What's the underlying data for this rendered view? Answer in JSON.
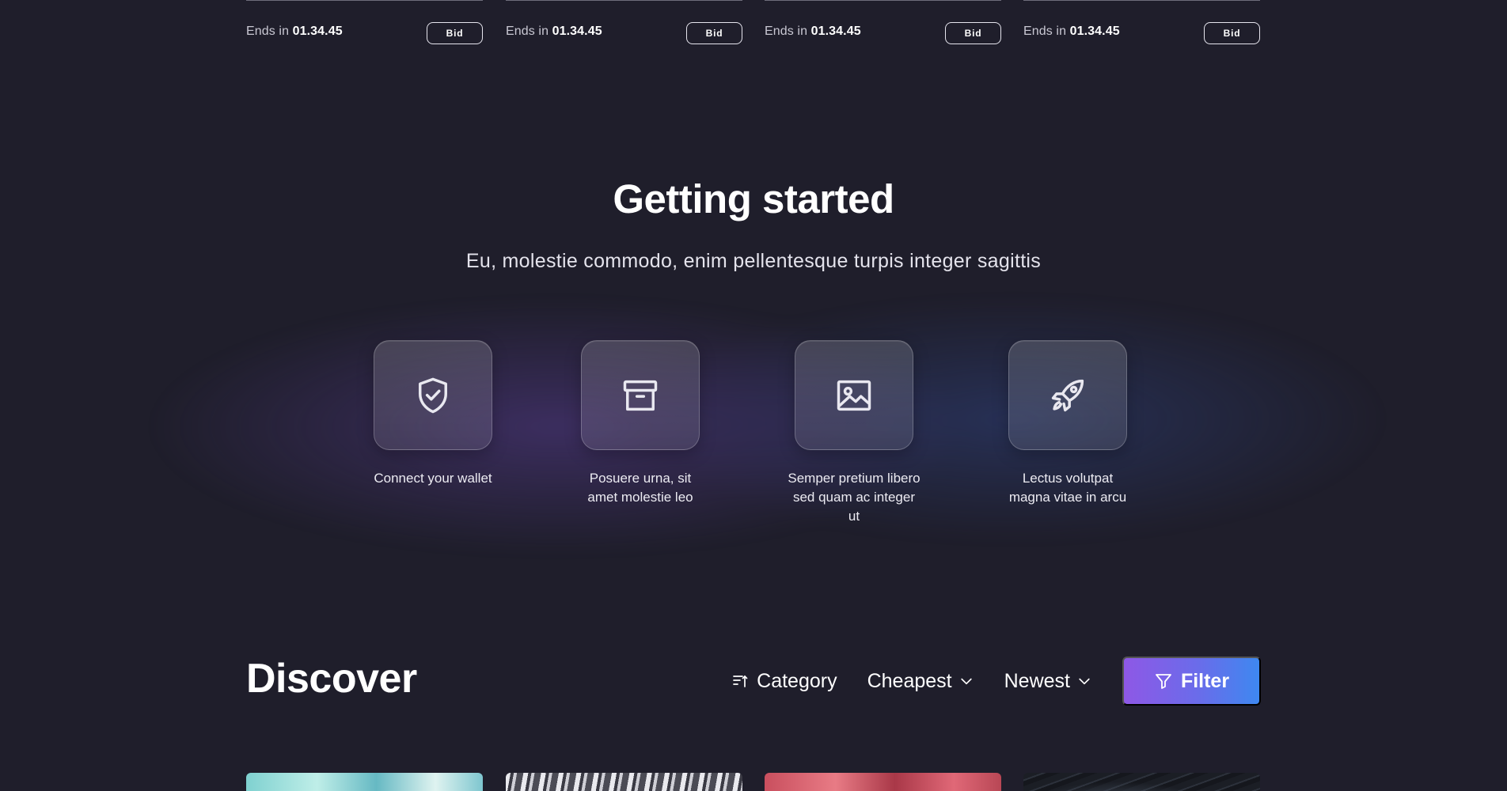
{
  "auctions": [
    {
      "ends_prefix": "Ends in",
      "time": "01.34.45",
      "bid_label": "Bid"
    },
    {
      "ends_prefix": "Ends in",
      "time": "01.34.45",
      "bid_label": "Bid"
    },
    {
      "ends_prefix": "Ends in",
      "time": "01.34.45",
      "bid_label": "Bid"
    },
    {
      "ends_prefix": "Ends in",
      "time": "01.34.45",
      "bid_label": "Bid"
    }
  ],
  "getting_started": {
    "title": "Getting started",
    "subtitle": "Eu, molestie commodo, enim pellentesque turpis integer sagittis",
    "steps": [
      {
        "icon": "shield-check-icon",
        "label": "Connect your wallet"
      },
      {
        "icon": "archive-icon",
        "label": "Posuere urna, sit amet molestie leo"
      },
      {
        "icon": "image-icon",
        "label": "Semper pretium libero sed quam ac integer ut"
      },
      {
        "icon": "rocket-icon",
        "label": "Lectus volutpat magna vitae in arcu"
      }
    ]
  },
  "discover": {
    "title": "Discover",
    "category_label": "Category",
    "sort_price_label": "Cheapest",
    "sort_date_label": "Newest",
    "filter_label": "Filter"
  },
  "colors": {
    "background": "#1f1e2b",
    "filter_gradient_start": "#8e58e6",
    "filter_gradient_end": "#3e88f0"
  }
}
